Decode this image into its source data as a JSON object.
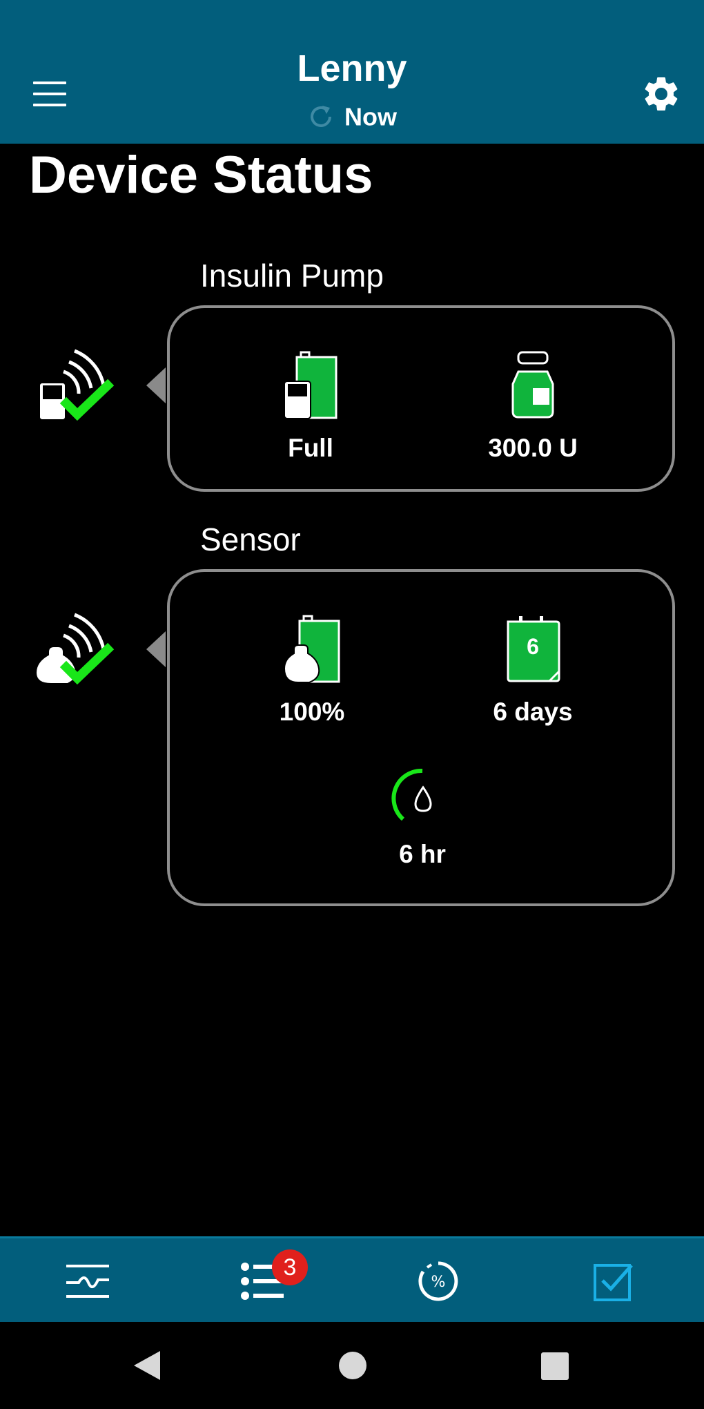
{
  "header": {
    "patient_name": "Lenny",
    "sync_status": "Now",
    "colors": {
      "background": "#025e7c"
    }
  },
  "page": {
    "title": "Device Status"
  },
  "insulin_pump": {
    "label": "Insulin Pump",
    "connection_icon": "pump-connected-check-icon",
    "battery": {
      "label": "Full",
      "icon": "pump-battery-icon"
    },
    "reservoir": {
      "label": "300.0 U",
      "icon": "insulin-reservoir-icon"
    }
  },
  "sensor": {
    "label": "Sensor",
    "connection_icon": "sensor-connected-check-icon",
    "battery": {
      "label": "100%",
      "icon": "sensor-battery-icon"
    },
    "life": {
      "label": "6 days",
      "calendar_number": "6",
      "icon": "sensor-calendar-icon"
    },
    "calibration": {
      "label": "6 hr",
      "icon": "calibration-timer-icon"
    }
  },
  "bottom_nav": {
    "items": [
      {
        "name": "graph",
        "icon": "glucose-graph-icon"
      },
      {
        "name": "notifications",
        "icon": "list-icon",
        "badge": "3"
      },
      {
        "name": "time-in-range",
        "icon": "percent-circle-icon"
      },
      {
        "name": "status",
        "icon": "checkbox-icon",
        "active": true
      }
    ],
    "active_color": "#1ab0e6"
  },
  "colors": {
    "accent_green": "#10b43c",
    "check_green": "#19e619",
    "badge_red": "#e0201c"
  }
}
